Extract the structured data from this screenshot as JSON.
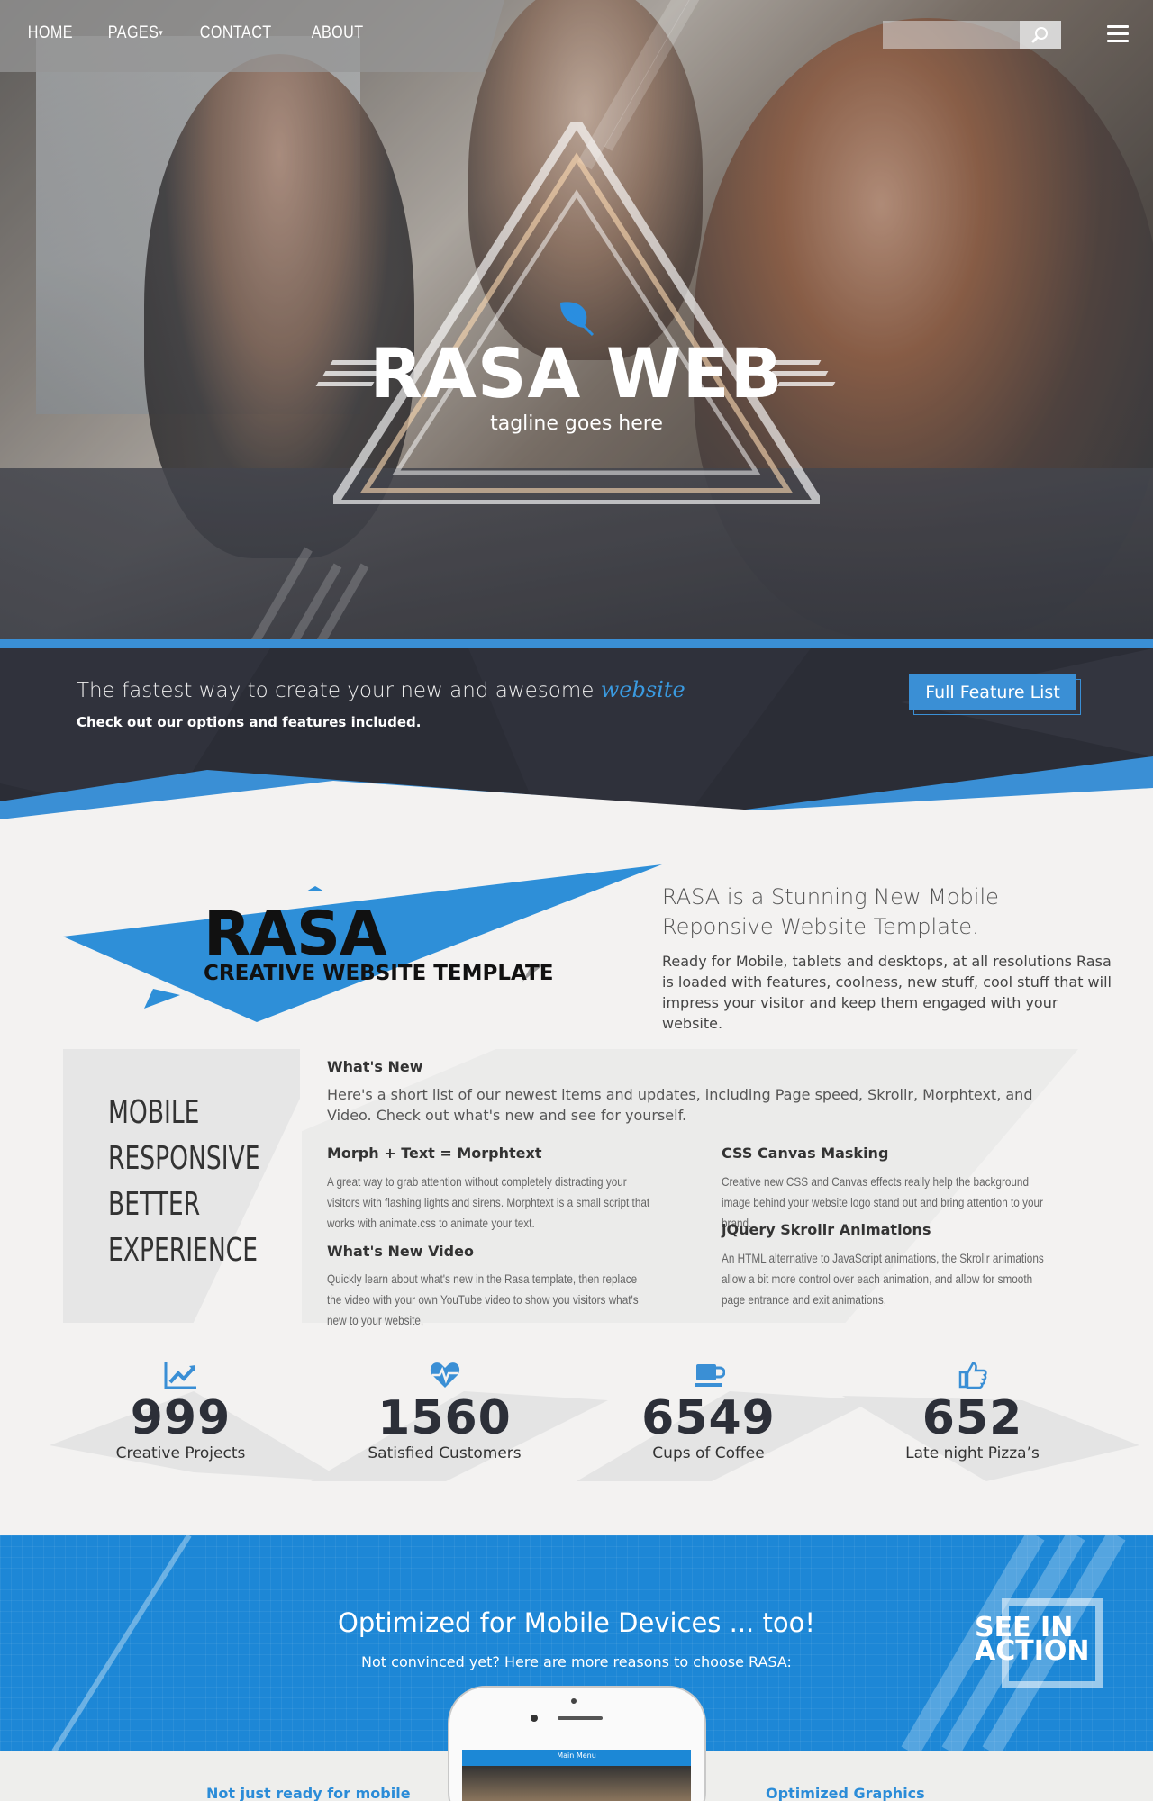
{
  "nav": {
    "links": [
      "HOME",
      "PAGES",
      "CONTACT",
      "ABOUT"
    ],
    "search_placeholder": ""
  },
  "hero": {
    "title": "RASA WEB",
    "tagline": "tagline goes here"
  },
  "cta": {
    "headline_main": "The fastest way to create your new and awesome ",
    "headline_accent": "website",
    "subtext": "Check out our options and features included.",
    "button": "Full Feature List"
  },
  "intro": {
    "logo_word": "RASA",
    "logo_sub": "CREATIVE WEBSITE TEMPLATE",
    "heading": "RASA is a Stunning New Mobile Reponsive Website Template.",
    "body": "Ready for Mobile, tablets and desktops, at all resolutions Rasa is loaded with features, coolness, new stuff, cool stuff that will impress your visitor and keep them engaged with your website."
  },
  "features": {
    "left_lines": [
      "MOBILE",
      "RESPONSIVE",
      "BETTER",
      "EXPERIENCE"
    ],
    "whats_new_title": "What's New",
    "whats_new_body": "Here's a short list of our newest items and updates, including Page speed, Skrollr, Morphtext, and Video. Check out what's new and see for yourself.",
    "items": [
      {
        "title": "Morph + Text = Morphtext",
        "body": "A great way to grab attention without completely distracting your visitors with flashing lights and sirens. Morphtext is a small script that works with animate.css to animate your text."
      },
      {
        "title": "CSS Canvas Masking",
        "body": "Creative new CSS and Canvas effects really help the background image behind your website logo stand out and bring attention to your brand."
      },
      {
        "title": "What's New Video",
        "body": "Quickly learn about what's new in the Rasa template, then replace the video with your own YouTube video to show you visitors what's new to your website,"
      },
      {
        "title": "jQuery Skrollr Animations",
        "body": "An HTML alternative to JavaScript animations, the Skrollr animations allow a bit more control over each animation, and allow for smooth page entrance and exit animations,"
      }
    ]
  },
  "stats": [
    {
      "icon": "line-chart-icon",
      "value": "999",
      "label": "Creative Projects"
    },
    {
      "icon": "heartbeat-icon",
      "value": "1560",
      "label": "Satisfied Customers"
    },
    {
      "icon": "coffee-cup-icon",
      "value": "6549",
      "label": "Cups of Coffee"
    },
    {
      "icon": "thumbs-up-icon",
      "value": "652",
      "label": "Late night Pizza’s"
    }
  ],
  "promo": {
    "title": "Optimized for Mobile Devices ... too!",
    "subtitle": "Not convinced yet? Here are more reasons to choose RASA:",
    "see_line1": "SEE IN",
    "see_line2": "ACTION",
    "phone_menu": "Main Menu"
  },
  "bottom": {
    "left": "Not just ready for mobile",
    "right": "Optimized Graphics"
  },
  "colors": {
    "accent": "#3a8fd5",
    "dark_band": "#2b2d36",
    "promo_blue": "#1d87d6"
  }
}
